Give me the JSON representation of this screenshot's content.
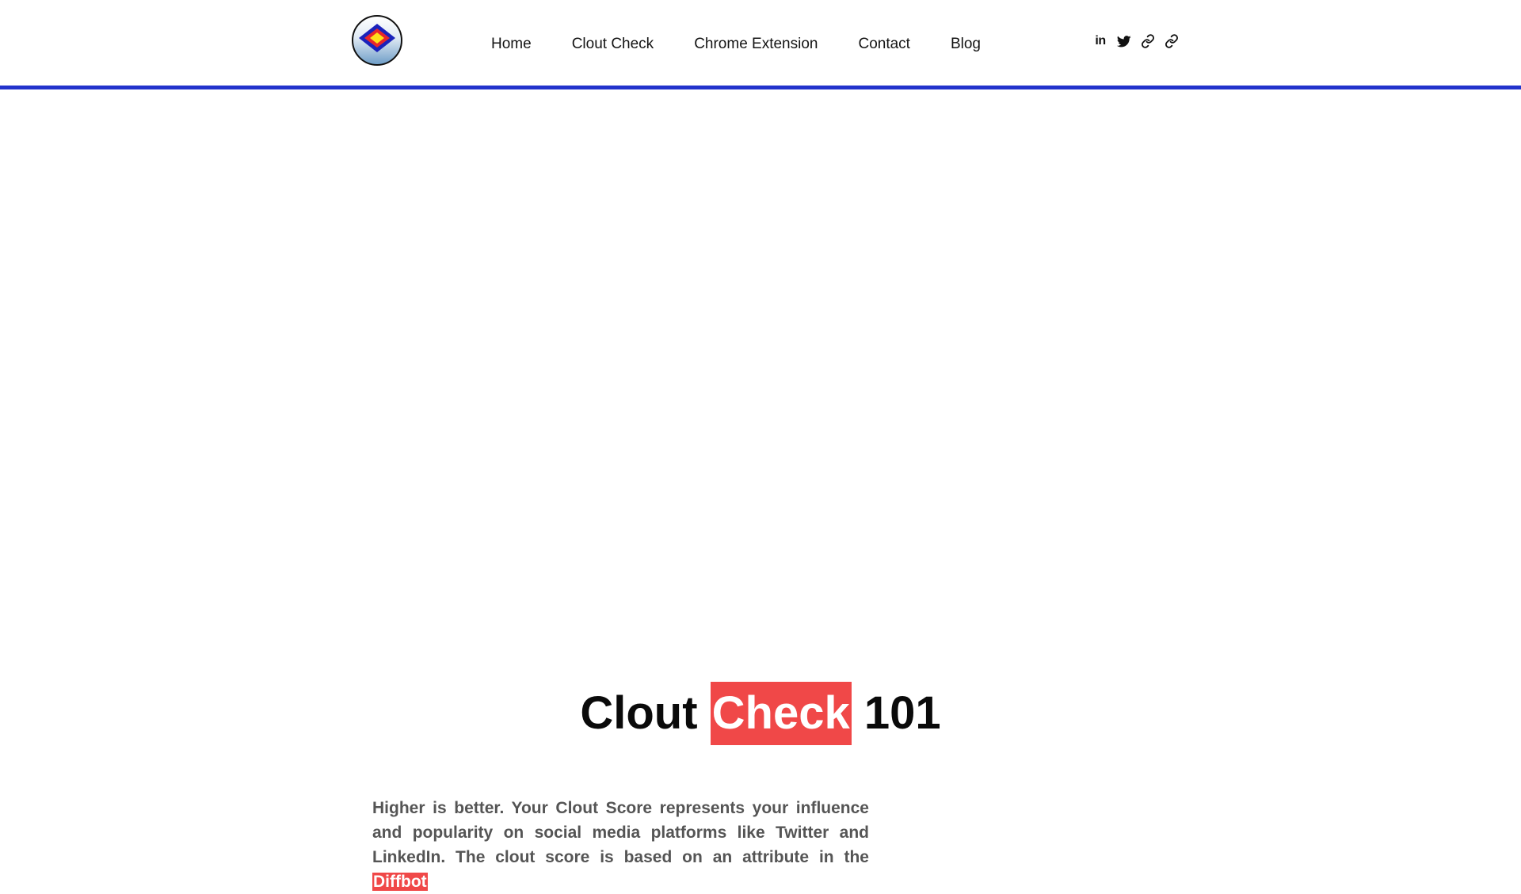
{
  "header": {
    "nav": [
      "Home",
      "Clout Check",
      "Chrome Extension",
      "Contact",
      "Blog"
    ],
    "social": [
      {
        "icon": "linkedin-icon",
        "label": "in"
      },
      {
        "icon": "twitter-icon"
      },
      {
        "icon": "link-icon"
      },
      {
        "icon": "link-icon"
      }
    ],
    "accent_color": "#2233cc"
  },
  "main": {
    "heading_part1": "Clout",
    "heading_highlight": "Check",
    "heading_part2": "101",
    "highlight_color": "#f04848",
    "paragraph_text": "Higher is better. Your Clout Score represents your influence and popularity on social media platforms like Twitter and LinkedIn. The clout score is based on an attribute in the",
    "paragraph_highlight": "Diffbot"
  }
}
